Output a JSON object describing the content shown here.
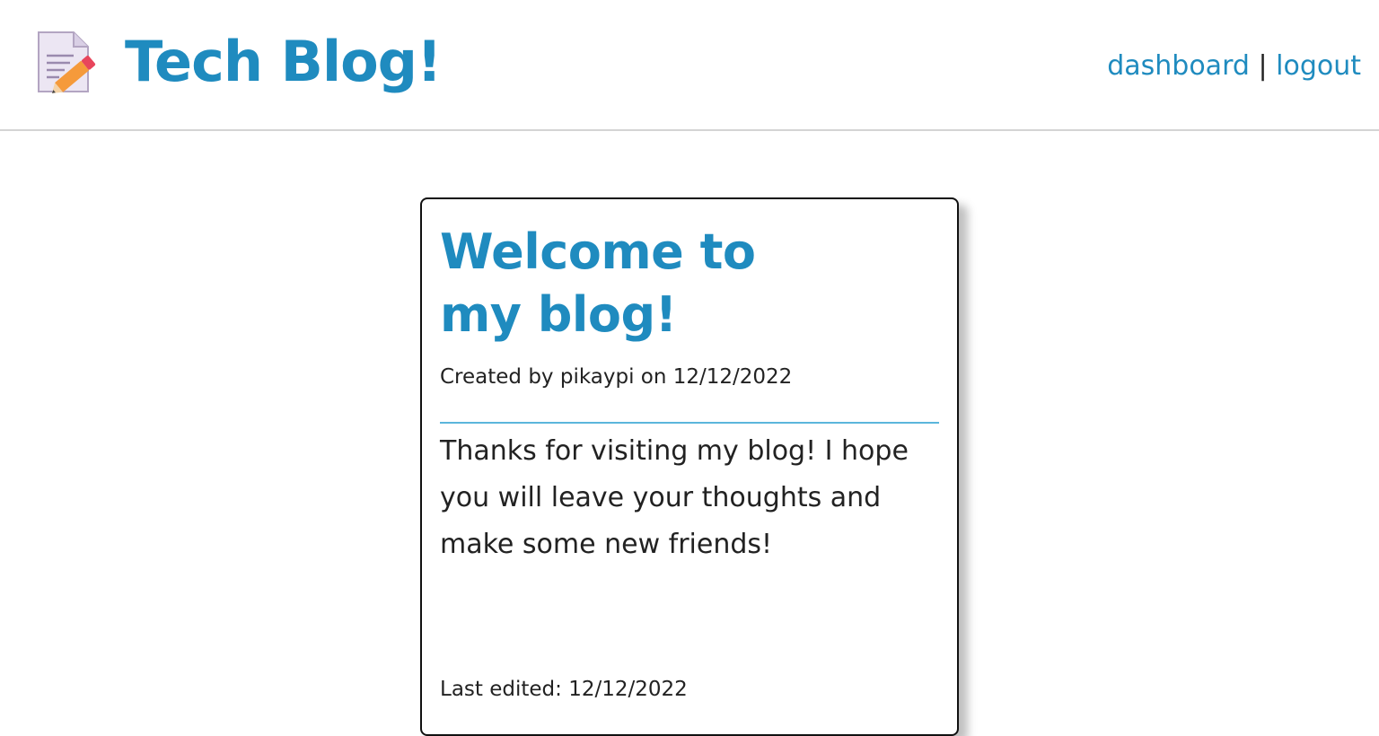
{
  "header": {
    "title": "Tech Blog!",
    "logo_icon": "memo-pencil-icon",
    "nav": {
      "dashboard": "dashboard",
      "separator": "|",
      "logout": "logout"
    }
  },
  "post": {
    "title": "Welcome to my blog!",
    "meta": "Created by pikaypi on 12/12/2022",
    "body": "Thanks for visiting my blog! I hope you will leave your thoughts and make some new friends!",
    "edited": "Last edited: 12/12/2022"
  },
  "colors": {
    "accent": "#1f8bbf",
    "divider": "#5bb6dc",
    "text": "#222222"
  }
}
